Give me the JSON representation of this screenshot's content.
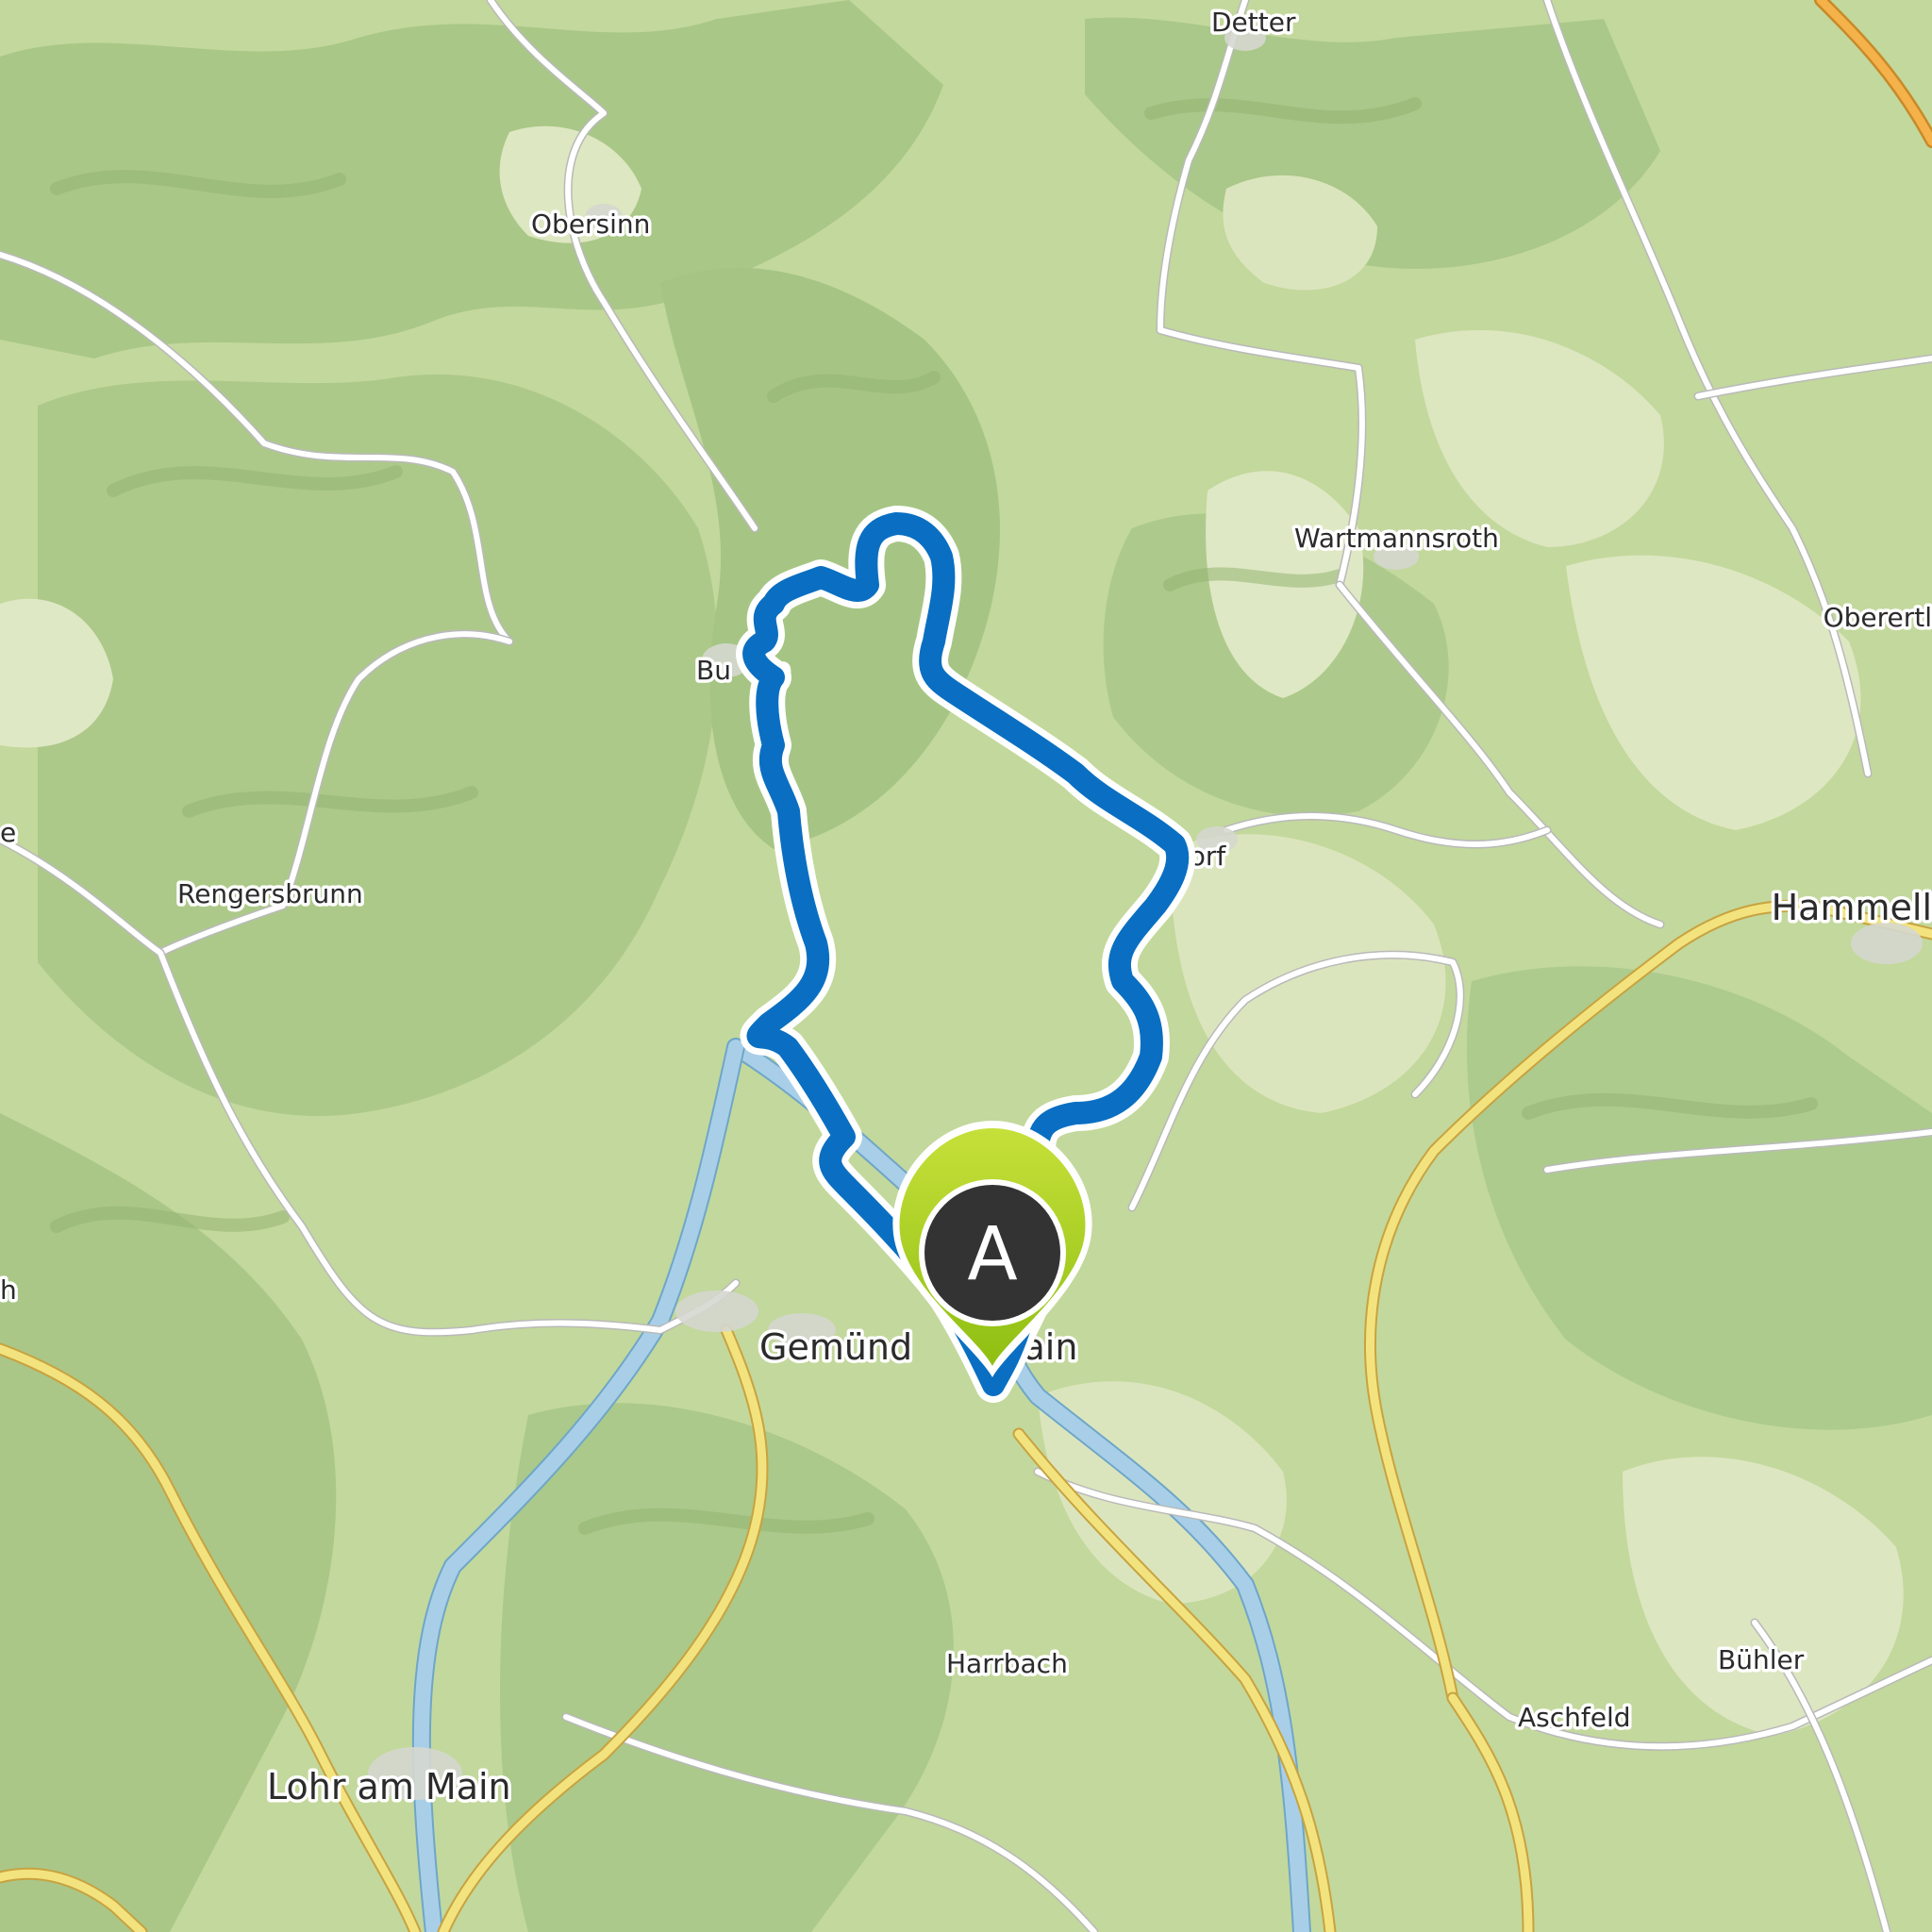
{
  "map": {
    "places": [
      {
        "id": "detter",
        "label": "Detter",
        "size": "small"
      },
      {
        "id": "obersinn",
        "label": "Obersinn",
        "size": "small"
      },
      {
        "id": "wartmannsroth",
        "label": "Wartmannsroth",
        "size": "small"
      },
      {
        "id": "oberertl",
        "label": "Oberertl",
        "size": "small"
      },
      {
        "id": "burgsinn",
        "label": "Bu     n",
        "size": "small"
      },
      {
        "id": "rengersbrunn",
        "label": "Rengersbrunn",
        "size": "small"
      },
      {
        "id": "dorf",
        "label": "dorf",
        "size": "small"
      },
      {
        "id": "hammell",
        "label": "Hammell",
        "size": "large"
      },
      {
        "id": "gemuenden",
        "label": "Gemünd       Main",
        "size": "large"
      },
      {
        "id": "harrbach",
        "label": "Harrbach",
        "size": "small"
      },
      {
        "id": "buehler",
        "label": "Bühler",
        "size": "small"
      },
      {
        "id": "aschfeld",
        "label": "Aschfeld",
        "size": "small"
      },
      {
        "id": "lohr",
        "label": "Lohr am Main",
        "size": "large"
      },
      {
        "id": "edge-e",
        "label": "e",
        "size": "small"
      },
      {
        "id": "edge-h",
        "label": "h",
        "size": "small"
      }
    ],
    "marker": {
      "label": "A",
      "fill": "#333333",
      "ring": "#a6cf1a"
    },
    "colors": {
      "route": "#0a6fc2",
      "forest": "#a9c787",
      "meadow": "#dfe8c4",
      "water": "#a9cfe8",
      "primary_road": "#f3e37f",
      "highway": "#f5b24b"
    }
  }
}
